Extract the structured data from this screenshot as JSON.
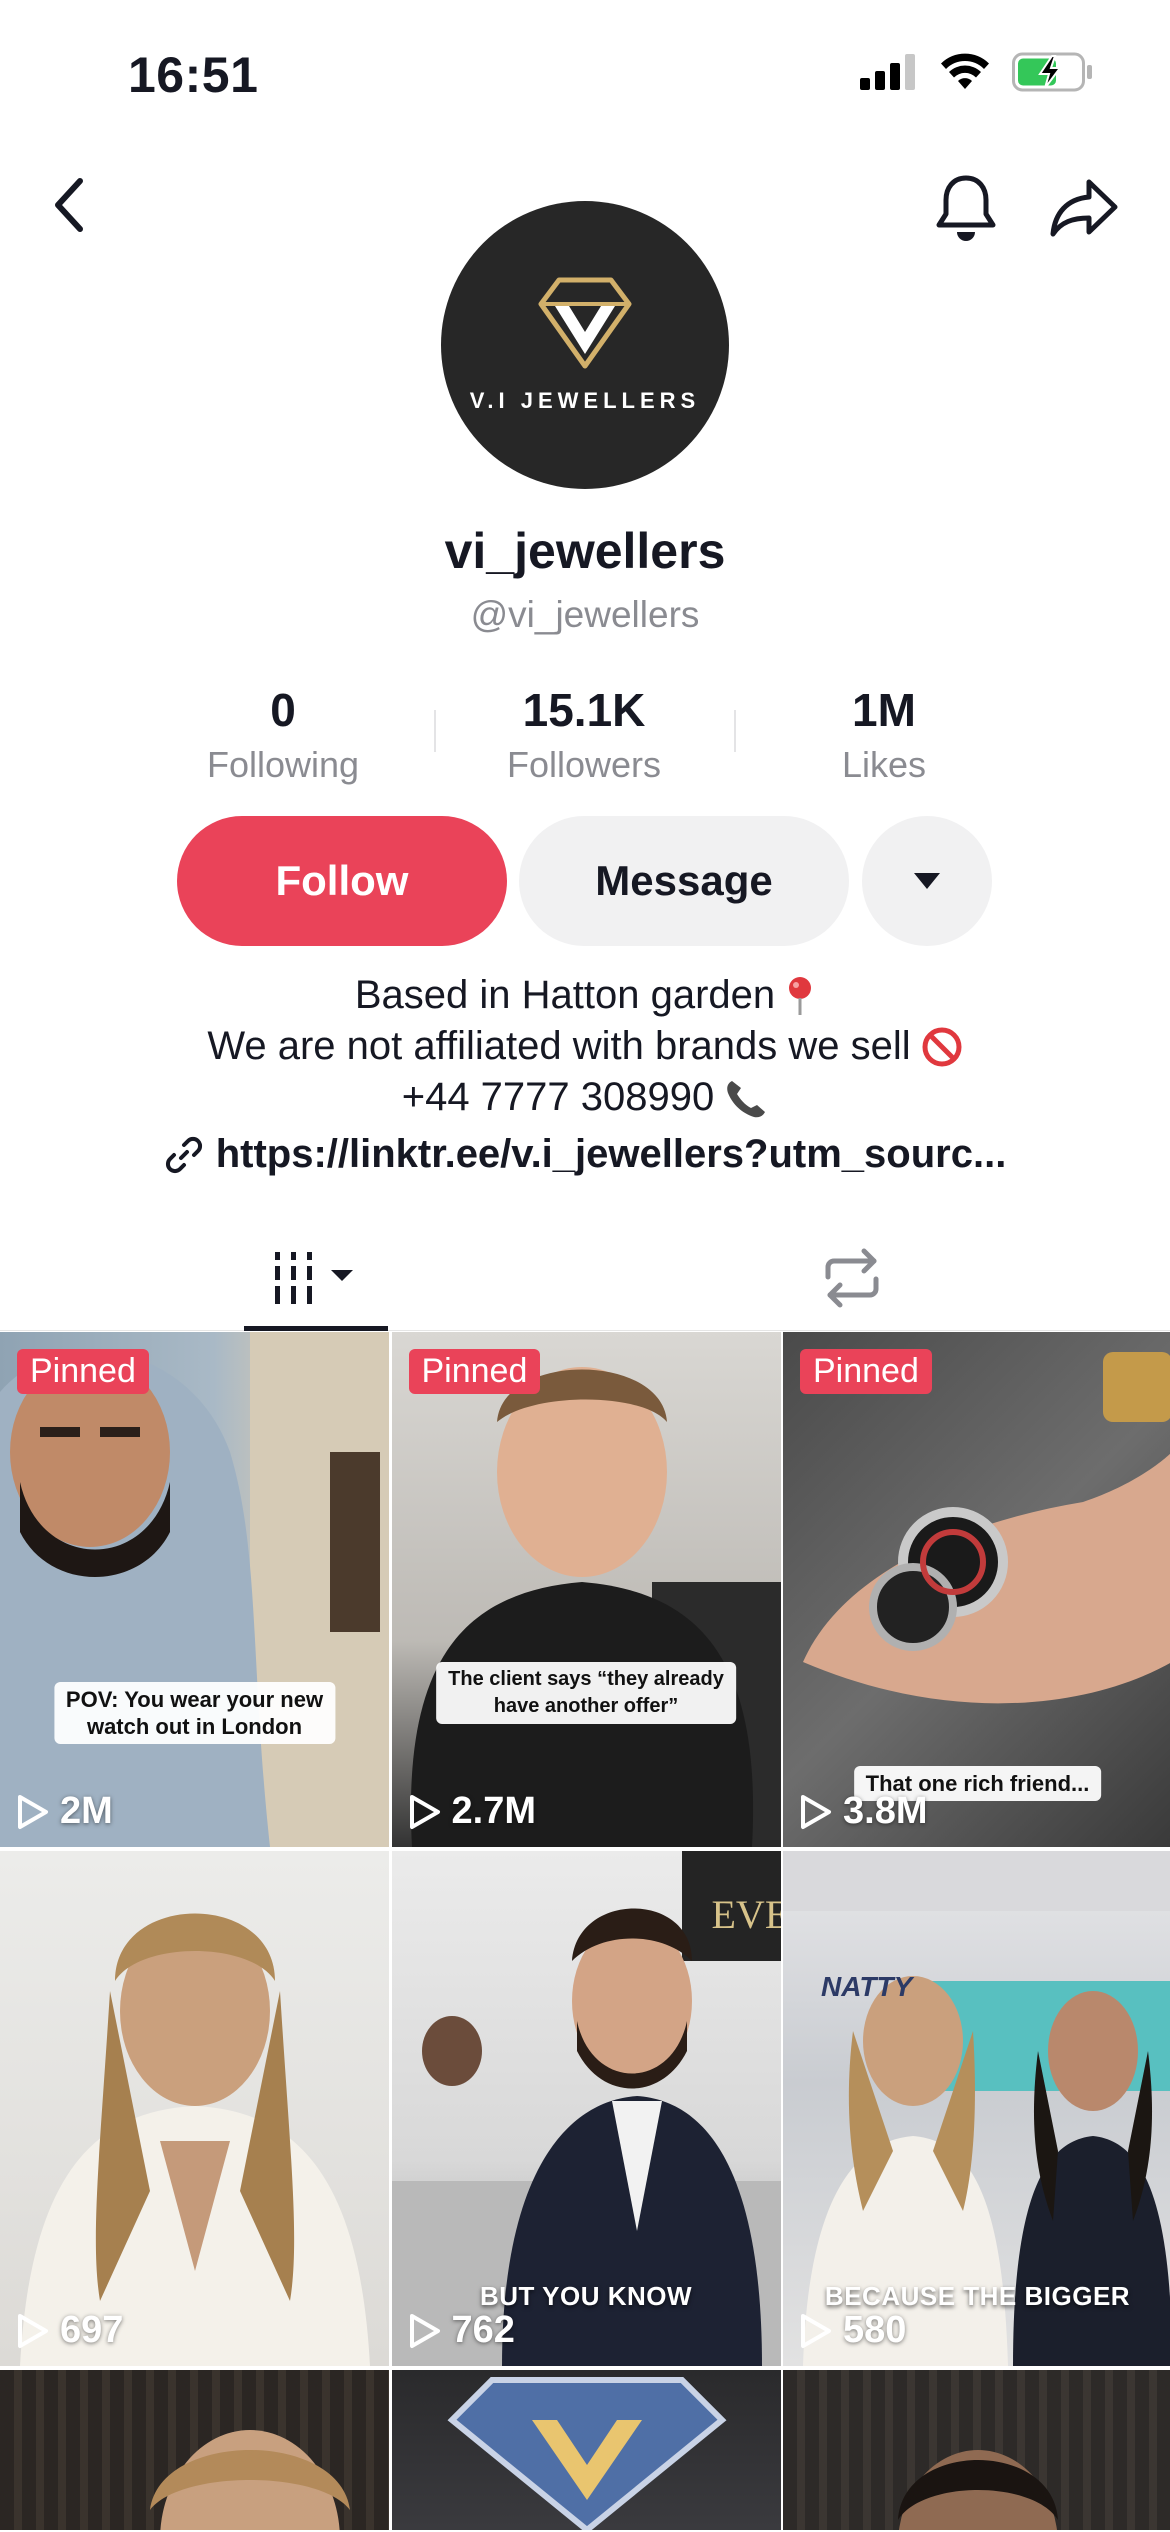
{
  "status_bar": {
    "time": "16:51"
  },
  "profile": {
    "avatar_brand": "V.I JEWELLERS",
    "username": "vi_jewellers",
    "handle": "@vi_jewellers"
  },
  "stats": [
    {
      "value": "0",
      "label": "Following"
    },
    {
      "value": "15.1K",
      "label": "Followers"
    },
    {
      "value": "1M",
      "label": "Likes"
    }
  ],
  "actions": {
    "follow": "Follow",
    "message": "Message"
  },
  "bio": {
    "line1": "Based in Hatton garden",
    "line2": "We are not affiliated with brands we sell",
    "line3": "+44 7777 308990",
    "link": "https://linktr.ee/v.i_jewellers?utm_sourc..."
  },
  "videos": [
    {
      "pinned": "Pinned",
      "caption": "POV: You wear your new\nwatch out in London",
      "views": "2M"
    },
    {
      "pinned": "Pinned",
      "caption": "The client says “they already\nhave another offer”",
      "views": "2.7M"
    },
    {
      "pinned": "Pinned",
      "caption": "That one rich friend...",
      "views": "3.8M"
    },
    {
      "views": "697"
    },
    {
      "overlay_text": "BUT YOU KNOW",
      "sign_text": "EVE",
      "views": "762"
    },
    {
      "overlay_text": "BECAUSE THE BIGGER",
      "sign_text": "NATTY",
      "views": "580"
    }
  ],
  "colors": {
    "accent": "#ea4359",
    "text": "#161823",
    "muted": "#8a8b91",
    "button_bg": "#f1f1f2"
  }
}
